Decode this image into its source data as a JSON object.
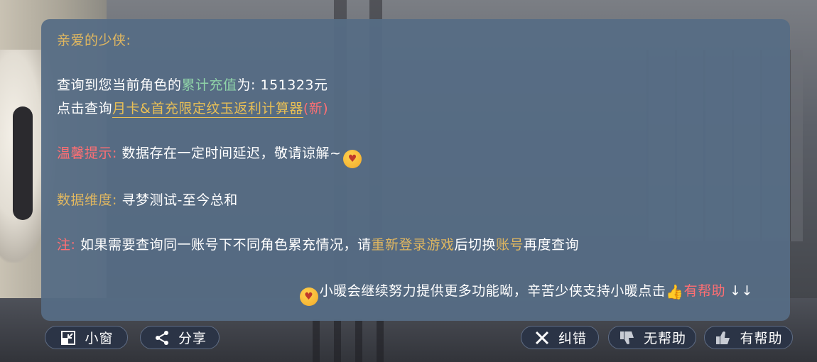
{
  "dialog": {
    "greeting": "亲爱的少侠:",
    "line1": {
      "prefix": "查询到您当前角色的",
      "highlight": "累计充值",
      "middle": "为: ",
      "value": "151323元"
    },
    "line2": {
      "prefix": "点击查询",
      "link": "月卡&首充限定纹玉返利计算器",
      "badge": "(新)"
    },
    "tip": {
      "label": "温馨提示:",
      "text": " 数据存在一定时间延迟，敬请谅解~"
    },
    "dimension": {
      "label": "数据维度:",
      "text": " 寻梦测试-至今总和"
    },
    "note": {
      "label": "注:",
      "text1": " 如果需要查询同一账号下不同角色累充情况，请",
      "hl1": "重新登录游戏",
      "text2": "后切换",
      "hl2": "账号",
      "text3": "再度查询"
    },
    "footer": {
      "text": "小暖会继续努力提供更多功能呦，辛苦少侠支持小暖点击",
      "helpful": "有帮助",
      "arrows": "↓↓"
    }
  },
  "toolbar": {
    "small_window": "小窗",
    "share": "分享",
    "correct": "纠错",
    "not_helpful": "无帮助",
    "helpful": "有帮助"
  }
}
